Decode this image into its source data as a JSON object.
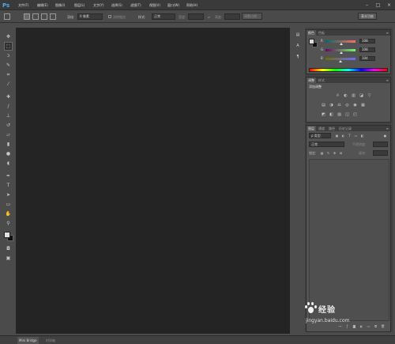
{
  "app": {
    "logo": "Ps"
  },
  "menu": [
    "文件(F)",
    "编辑(E)",
    "图像(I)",
    "图层(L)",
    "文字(Y)",
    "选择(S)",
    "滤镜(T)",
    "视图(V)",
    "窗口(W)",
    "帮助(H)"
  ],
  "window_controls": [
    "–",
    "□",
    "×"
  ],
  "options": {
    "feather_label": "羽化:",
    "feather_value": "0 像素",
    "antialias_label": "消除锯齿",
    "style_label": "样式:",
    "style_value": "正常",
    "width_label": "宽度:",
    "height_label": "高度:",
    "refine_label": "调整边缘...",
    "workspace_label": "基本功能"
  },
  "tools": [
    "move-tool",
    "marquee-tool",
    "lasso-tool",
    "quick-select-tool",
    "crop-tool",
    "eyedropper-tool",
    "spot-heal-tool",
    "brush-tool",
    "stamp-tool",
    "history-brush-tool",
    "eraser-tool",
    "gradient-tool",
    "blur-tool",
    "dodge-tool",
    "pen-tool",
    "type-tool",
    "path-select-tool",
    "shape-tool",
    "hand-tool",
    "zoom-tool"
  ],
  "status_tabs": {
    "mini_bridge": "Mini Bridge",
    "timeline": "时间轴"
  },
  "color_panel": {
    "tabs": [
      "颜色",
      "色板"
    ],
    "menu": "≡",
    "channels": [
      {
        "label": "R",
        "value": "108"
      },
      {
        "label": "G",
        "value": "108"
      },
      {
        "label": "B",
        "value": "104"
      }
    ]
  },
  "adjustments_panel": {
    "tabs": [
      "调整",
      "样式"
    ],
    "title": "添加调整",
    "row1": [
      "☼",
      "◐",
      "▥",
      "◪",
      "▽"
    ],
    "row2": [
      "▤",
      "◑",
      "⚖",
      "◎",
      "◉",
      "▦"
    ],
    "row3": [
      "◩",
      "◧",
      "▨",
      "◫",
      "◰"
    ]
  },
  "layers_panel": {
    "tabs": [
      "图层",
      "通道",
      "路径",
      "历史记录"
    ],
    "kind_label": "ρ 类型",
    "blend_mode": "正常",
    "opacity_label": "不透明度:",
    "lock_label": "锁定:",
    "fill_label": "填充:"
  },
  "watermark": {
    "brand": "经验",
    "url": "jingyan.baidu.com"
  },
  "colors": {
    "canvas": "#242424",
    "ui": "#535353",
    "ps_logo": "#4cabf0"
  }
}
